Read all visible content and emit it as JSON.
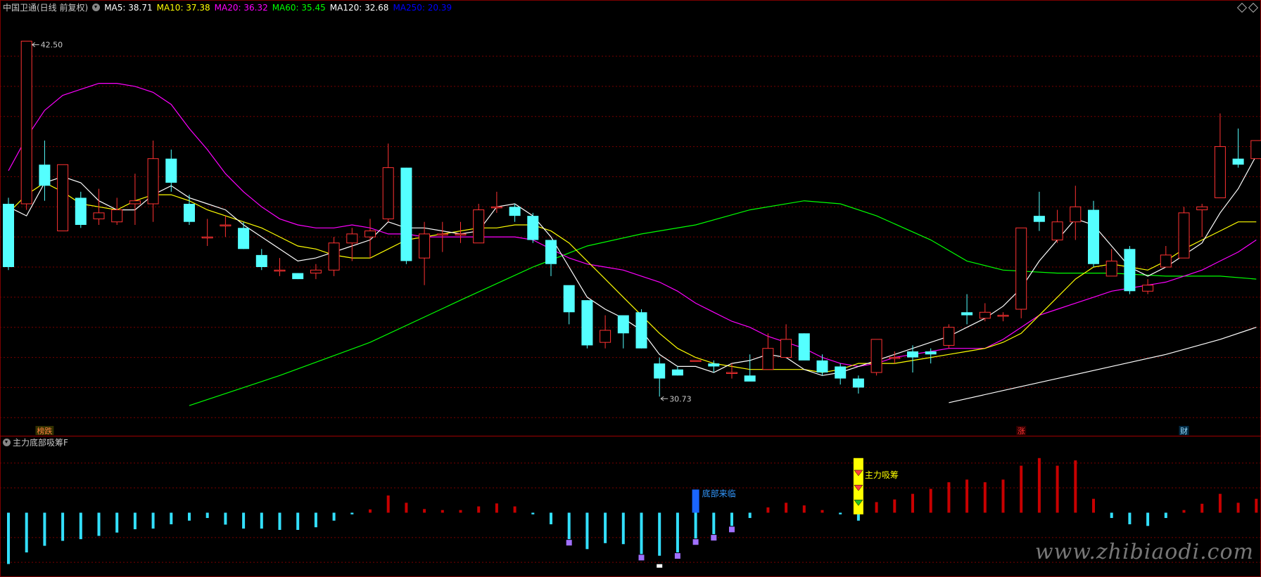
{
  "header": {
    "title": "中国卫通(日线 前复权)",
    "ma": [
      {
        "label": "MA5: 38.71",
        "color": "#ffffff"
      },
      {
        "label": "MA10: 37.38",
        "color": "#ffff00"
      },
      {
        "label": "MA20: 36.32",
        "color": "#ff00ff"
      },
      {
        "label": "MA60: 35.45",
        "color": "#00ff00"
      },
      {
        "label": "MA120: 32.68",
        "color": "#ffffff"
      },
      {
        "label": "MA250: 20.39",
        "color": "#0000ff"
      }
    ]
  },
  "chart_data": {
    "type": "candlestick",
    "ylim": [
      29.4,
      43.4
    ],
    "high_label": "42.50",
    "low_label": "30.73",
    "colors": {
      "up": "#ff3232",
      "down": "#54ffff",
      "ma5": "#ffffff",
      "ma10": "#ffff00",
      "ma20": "#ff00ff",
      "ma60": "#00ff00",
      "ma120": "#ffffff",
      "grid": "#7a0000"
    },
    "candles": [
      [
        37.1,
        35.0,
        37.3,
        34.9
      ],
      [
        37.1,
        42.5,
        42.5,
        36.9
      ],
      [
        38.4,
        37.7,
        39.2,
        37.2
      ],
      [
        36.2,
        38.4,
        38.4,
        36.2
      ],
      [
        37.3,
        36.4,
        37.5,
        36.3
      ],
      [
        36.6,
        36.8,
        37.6,
        36.4
      ],
      [
        36.5,
        36.9,
        37.3,
        36.4
      ],
      [
        37.1,
        37.2,
        38.1,
        36.4
      ],
      [
        37.1,
        38.6,
        39.2,
        36.5
      ],
      [
        38.6,
        37.8,
        38.9,
        37.5
      ],
      [
        37.1,
        36.5,
        37.4,
        36.4
      ],
      [
        36.0,
        36.0,
        36.6,
        35.7
      ],
      [
        36.4,
        36.4,
        36.7,
        36.0
      ],
      [
        36.3,
        35.6,
        36.5,
        35.6
      ],
      [
        35.4,
        35.0,
        35.6,
        34.9
      ],
      [
        34.9,
        34.9,
        35.3,
        34.7
      ],
      [
        34.8,
        34.6,
        34.8,
        34.6
      ],
      [
        34.8,
        34.9,
        35.1,
        34.6
      ],
      [
        34.9,
        35.8,
        36.0,
        34.7
      ],
      [
        35.8,
        36.1,
        36.3,
        35.2
      ],
      [
        36.0,
        36.2,
        36.6,
        35.3
      ],
      [
        36.6,
        38.3,
        39.1,
        36.5
      ],
      [
        38.3,
        35.2,
        38.3,
        35.1
      ],
      [
        35.3,
        36.1,
        36.5,
        34.4
      ],
      [
        36.1,
        36.1,
        36.5,
        35.5
      ],
      [
        36.1,
        36.1,
        36.5,
        35.8
      ],
      [
        35.8,
        36.9,
        37.1,
        35.8
      ],
      [
        37.0,
        37.0,
        37.5,
        36.8
      ],
      [
        37.0,
        36.7,
        37.1,
        36.5
      ],
      [
        36.7,
        35.9,
        36.8,
        35.8
      ],
      [
        35.9,
        35.1,
        35.1,
        34.7
      ],
      [
        34.4,
        33.5,
        34.3,
        33.1
      ],
      [
        33.9,
        32.4,
        33.9,
        32.3
      ],
      [
        32.5,
        32.9,
        33.4,
        32.3
      ],
      [
        33.4,
        32.8,
        32.9,
        32.3
      ],
      [
        33.5,
        32.3,
        33.6,
        32.3
      ],
      [
        31.8,
        31.3,
        32.0,
        30.7
      ],
      [
        31.6,
        31.4,
        31.7,
        31.4
      ],
      [
        31.9,
        31.9,
        31.9,
        31.9
      ],
      [
        31.8,
        31.7,
        31.9,
        31.5
      ],
      [
        31.5,
        31.5,
        31.8,
        31.3
      ],
      [
        31.4,
        31.2,
        32.1,
        31.3
      ],
      [
        31.6,
        32.3,
        32.8,
        31.8
      ],
      [
        32.0,
        32.6,
        33.1,
        32.2
      ],
      [
        32.8,
        31.9,
        32.8,
        32.2
      ],
      [
        31.9,
        31.5,
        32.1,
        31.4
      ],
      [
        31.7,
        31.3,
        31.8,
        31.1
      ],
      [
        31.3,
        31.0,
        31.4,
        30.8
      ],
      [
        31.5,
        32.6,
        32.6,
        31.4
      ],
      [
        32.0,
        32.0,
        32.2,
        31.8
      ],
      [
        32.2,
        32.0,
        32.4,
        31.5
      ],
      [
        32.2,
        32.1,
        32.3,
        31.8
      ],
      [
        32.4,
        33.0,
        33.1,
        32.3
      ],
      [
        33.5,
        33.4,
        34.1,
        33.1
      ],
      [
        33.3,
        33.5,
        33.8,
        33.2
      ],
      [
        33.4,
        33.4,
        33.5,
        33.2
      ],
      [
        33.6,
        36.3,
        36.3,
        33.3
      ],
      [
        36.7,
        36.5,
        37.5,
        36.2
      ],
      [
        35.9,
        36.5,
        36.9,
        35.8
      ],
      [
        36.5,
        37.0,
        37.7,
        35.9
      ],
      [
        36.9,
        35.1,
        37.2,
        35.0
      ],
      [
        34.7,
        35.2,
        35.6,
        34.8
      ],
      [
        35.6,
        34.2,
        35.7,
        34.1
      ],
      [
        34.2,
        34.4,
        34.6,
        34.1
      ],
      [
        35.0,
        35.4,
        35.7,
        35.3
      ],
      [
        35.3,
        36.8,
        37.0,
        35.3
      ],
      [
        36.9,
        37.0,
        37.1,
        36.0
      ],
      [
        37.3,
        39.0,
        40.1,
        38.1
      ],
      [
        38.6,
        38.4,
        39.6,
        38.3
      ],
      [
        38.6,
        39.2,
        39.2,
        38.8
      ]
    ],
    "ma5": [
      [
        0,
        37.0
      ],
      [
        1,
        36.7
      ],
      [
        2,
        37.8
      ],
      [
        3,
        38.0
      ],
      [
        4,
        37.8
      ],
      [
        5,
        37.2
      ],
      [
        6,
        36.9
      ],
      [
        7,
        36.9
      ],
      [
        8,
        37.4
      ],
      [
        9,
        37.7
      ],
      [
        10,
        37.3
      ],
      [
        11,
        37.1
      ],
      [
        12,
        36.9
      ],
      [
        13,
        36.4
      ],
      [
        14,
        36.0
      ],
      [
        15,
        35.6
      ],
      [
        16,
        35.2
      ],
      [
        17,
        35.3
      ],
      [
        18,
        35.5
      ],
      [
        19,
        35.7
      ],
      [
        20,
        35.9
      ],
      [
        21,
        36.5
      ],
      [
        22,
        36.3
      ],
      [
        23,
        36.3
      ],
      [
        24,
        36.2
      ],
      [
        25,
        36.1
      ],
      [
        26,
        36.2
      ],
      [
        27,
        37.0
      ],
      [
        28,
        37.1
      ],
      [
        29,
        36.7
      ],
      [
        30,
        36.0
      ],
      [
        31,
        35.0
      ],
      [
        32,
        34.0
      ],
      [
        33,
        33.6
      ],
      [
        34,
        33.3
      ],
      [
        35,
        32.9
      ],
      [
        36,
        32.1
      ],
      [
        37,
        31.7
      ],
      [
        38,
        31.7
      ],
      [
        39,
        31.5
      ],
      [
        40,
        31.8
      ],
      [
        41,
        31.9
      ],
      [
        42,
        32.1
      ],
      [
        43,
        32.0
      ],
      [
        44,
        31.6
      ],
      [
        45,
        31.4
      ],
      [
        46,
        31.5
      ],
      [
        47,
        31.7
      ],
      [
        48,
        31.9
      ],
      [
        49,
        32.1
      ],
      [
        50,
        32.3
      ],
      [
        51,
        32.5
      ],
      [
        52,
        32.7
      ],
      [
        53,
        33.0
      ],
      [
        54,
        33.3
      ],
      [
        55,
        33.7
      ],
      [
        56,
        34.3
      ],
      [
        57,
        35.2
      ],
      [
        58,
        35.9
      ],
      [
        59,
        36.6
      ],
      [
        60,
        36.4
      ],
      [
        61,
        35.7
      ],
      [
        62,
        35.0
      ],
      [
        63,
        34.7
      ],
      [
        64,
        35.0
      ],
      [
        65,
        35.4
      ],
      [
        66,
        35.8
      ],
      [
        67,
        36.8
      ],
      [
        68,
        37.6
      ],
      [
        69,
        38.7
      ]
    ],
    "ma10": [
      [
        0,
        36.8
      ],
      [
        1,
        37.4
      ],
      [
        2,
        37.8
      ],
      [
        3,
        37.5
      ],
      [
        4,
        37.1
      ],
      [
        5,
        37.0
      ],
      [
        6,
        36.9
      ],
      [
        7,
        37.2
      ],
      [
        8,
        37.4
      ],
      [
        9,
        37.4
      ],
      [
        10,
        37.2
      ],
      [
        11,
        36.9
      ],
      [
        12,
        36.7
      ],
      [
        13,
        36.5
      ],
      [
        14,
        36.3
      ],
      [
        15,
        36.0
      ],
      [
        16,
        35.7
      ],
      [
        17,
        35.6
      ],
      [
        18,
        35.4
      ],
      [
        19,
        35.3
      ],
      [
        20,
        35.3
      ],
      [
        21,
        35.6
      ],
      [
        22,
        35.9
      ],
      [
        23,
        36.0
      ],
      [
        24,
        36.1
      ],
      [
        25,
        36.2
      ],
      [
        26,
        36.3
      ],
      [
        27,
        36.3
      ],
      [
        28,
        36.4
      ],
      [
        29,
        36.4
      ],
      [
        30,
        36.2
      ],
      [
        31,
        35.8
      ],
      [
        32,
        35.2
      ],
      [
        33,
        34.6
      ],
      [
        34,
        34.0
      ],
      [
        35,
        33.4
      ],
      [
        36,
        32.8
      ],
      [
        37,
        32.3
      ],
      [
        38,
        32.0
      ],
      [
        39,
        31.8
      ],
      [
        40,
        31.7
      ],
      [
        41,
        31.6
      ],
      [
        42,
        31.6
      ],
      [
        43,
        31.6
      ],
      [
        44,
        31.6
      ],
      [
        45,
        31.5
      ],
      [
        46,
        31.6
      ],
      [
        47,
        31.8
      ],
      [
        48,
        31.8
      ],
      [
        49,
        31.8
      ],
      [
        50,
        31.9
      ],
      [
        51,
        32.0
      ],
      [
        52,
        32.1
      ],
      [
        53,
        32.2
      ],
      [
        54,
        32.3
      ],
      [
        55,
        32.5
      ],
      [
        56,
        32.8
      ],
      [
        57,
        33.4
      ],
      [
        58,
        34.0
      ],
      [
        59,
        34.6
      ],
      [
        60,
        35.0
      ],
      [
        61,
        35.1
      ],
      [
        62,
        35.0
      ],
      [
        63,
        34.9
      ],
      [
        64,
        35.2
      ],
      [
        65,
        35.6
      ],
      [
        66,
        35.9
      ],
      [
        67,
        36.2
      ],
      [
        68,
        36.5
      ],
      [
        69,
        36.5
      ]
    ],
    "ma20": [
      [
        0,
        38.2
      ],
      [
        1,
        39.3
      ],
      [
        2,
        40.2
      ],
      [
        3,
        40.7
      ],
      [
        4,
        40.9
      ],
      [
        5,
        41.1
      ],
      [
        6,
        41.1
      ],
      [
        7,
        41.0
      ],
      [
        8,
        40.8
      ],
      [
        9,
        40.4
      ],
      [
        10,
        39.6
      ],
      [
        11,
        38.9
      ],
      [
        12,
        38.1
      ],
      [
        13,
        37.5
      ],
      [
        14,
        37.0
      ],
      [
        15,
        36.6
      ],
      [
        16,
        36.4
      ],
      [
        17,
        36.3
      ],
      [
        18,
        36.3
      ],
      [
        19,
        36.4
      ],
      [
        20,
        36.3
      ],
      [
        21,
        36.1
      ],
      [
        22,
        36.1
      ],
      [
        23,
        36.0
      ],
      [
        24,
        36.0
      ],
      [
        25,
        36.0
      ],
      [
        26,
        36.0
      ],
      [
        27,
        36.0
      ],
      [
        28,
        36.0
      ],
      [
        29,
        35.9
      ],
      [
        30,
        35.6
      ],
      [
        31,
        35.3
      ],
      [
        32,
        35.1
      ],
      [
        33,
        35.0
      ],
      [
        34,
        34.9
      ],
      [
        35,
        34.7
      ],
      [
        36,
        34.5
      ],
      [
        37,
        34.2
      ],
      [
        38,
        33.8
      ],
      [
        39,
        33.5
      ],
      [
        40,
        33.2
      ],
      [
        41,
        33.0
      ],
      [
        42,
        32.7
      ],
      [
        43,
        32.5
      ],
      [
        44,
        32.3
      ],
      [
        45,
        32.0
      ],
      [
        46,
        31.8
      ],
      [
        47,
        31.7
      ],
      [
        48,
        31.8
      ],
      [
        49,
        32.0
      ],
      [
        50,
        32.1
      ],
      [
        51,
        32.2
      ],
      [
        52,
        32.3
      ],
      [
        53,
        32.3
      ],
      [
        54,
        32.3
      ],
      [
        55,
        32.6
      ],
      [
        56,
        33.0
      ],
      [
        57,
        33.4
      ],
      [
        58,
        33.6
      ],
      [
        59,
        33.8
      ],
      [
        60,
        34.0
      ],
      [
        61,
        34.2
      ],
      [
        62,
        34.3
      ],
      [
        63,
        34.4
      ],
      [
        64,
        34.5
      ],
      [
        65,
        34.7
      ],
      [
        66,
        34.9
      ],
      [
        67,
        35.2
      ],
      [
        68,
        35.5
      ],
      [
        69,
        35.9
      ]
    ],
    "ma60": [
      [
        10,
        30.4
      ],
      [
        15,
        31.4
      ],
      [
        20,
        32.5
      ],
      [
        25,
        33.9
      ],
      [
        29,
        35.0
      ],
      [
        32,
        35.7
      ],
      [
        35,
        36.1
      ],
      [
        38,
        36.4
      ],
      [
        41,
        36.9
      ],
      [
        44,
        37.2
      ],
      [
        46,
        37.1
      ],
      [
        48,
        36.7
      ],
      [
        51,
        35.9
      ],
      [
        53,
        35.2
      ],
      [
        55,
        34.9
      ],
      [
        58,
        34.8
      ],
      [
        61,
        34.8
      ],
      [
        64,
        34.7
      ],
      [
        67,
        34.7
      ],
      [
        69,
        34.6
      ]
    ],
    "ma120": [
      [
        52,
        30.5
      ],
      [
        55,
        30.9
      ],
      [
        58,
        31.3
      ],
      [
        61,
        31.7
      ],
      [
        64,
        32.1
      ],
      [
        67,
        32.6
      ],
      [
        69,
        33.0
      ]
    ],
    "main_labels": [
      {
        "text": "榜跌",
        "color": "#ff8040",
        "bg": "#303000",
        "i": 2
      },
      {
        "text": "涨",
        "color": "#ff3232",
        "bg": "#300000",
        "i": 56
      },
      {
        "text": "财",
        "color": "#9fdfff",
        "bg": "#002a44",
        "i": 65
      }
    ],
    "indicator": {
      "title": "主力底部吸筹F",
      "ylim": [
        -1.9,
        1.9
      ],
      "values": [
        -1.55,
        -1.2,
        -1.0,
        -0.85,
        -0.8,
        -0.7,
        -0.6,
        -0.5,
        -0.48,
        -0.35,
        -0.24,
        -0.16,
        -0.36,
        -0.48,
        -0.48,
        -0.52,
        -0.52,
        -0.44,
        -0.24,
        -0.05,
        0.1,
        0.52,
        0.3,
        0.11,
        0.08,
        0.08,
        0.19,
        0.28,
        0.19,
        -0.05,
        -0.35,
        -0.8,
        -1.1,
        -0.92,
        -0.95,
        -1.25,
        -1.3,
        -1.2,
        -0.78,
        -0.65,
        -0.4,
        -0.16,
        0.16,
        0.3,
        0.22,
        0.08,
        -0.05,
        -0.24,
        0.32,
        0.4,
        0.57,
        0.72,
        0.92,
        1.0,
        0.92,
        1.0,
        1.42,
        1.65,
        1.42,
        1.58,
        0.42,
        -0.16,
        -0.35,
        -0.4,
        -0.16,
        0.08,
        0.27,
        0.57,
        0.3,
        0.42
      ],
      "purple_marks": [
        31,
        35,
        37,
        38,
        39,
        40
      ],
      "white_marks": [
        36
      ],
      "blue_bar_index": 38,
      "blue_label": "底部来临",
      "yellow_bar_index": 47,
      "yellow_label": "主力吸筹"
    }
  },
  "watermark": "www.zhibiaodi.com"
}
